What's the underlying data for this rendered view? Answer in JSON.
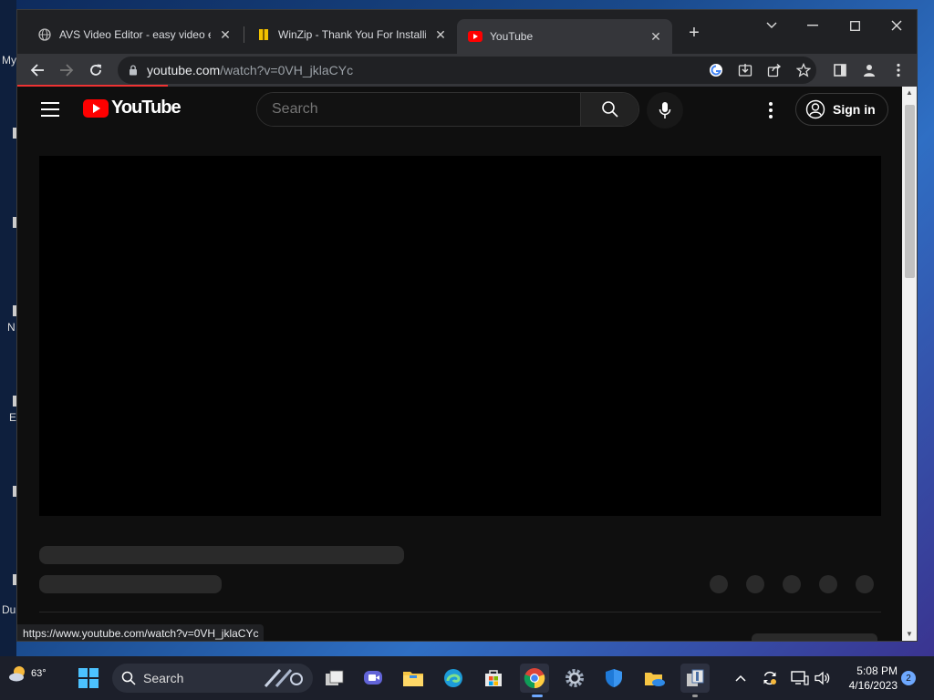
{
  "desktop": {
    "labels": [
      "My",
      "N",
      "E",
      "Du"
    ]
  },
  "browser": {
    "tabs": [
      {
        "title": "AVS Video Editor - easy video editing",
        "favicon": "globe-icon"
      },
      {
        "title": "WinZip - Thank You For Installing",
        "favicon": "winzip-icon"
      },
      {
        "title": "YouTube",
        "favicon": "youtube-icon",
        "active": true
      }
    ],
    "new_tab_label": "+",
    "close_glyph": "✕",
    "url_host": "youtube.com",
    "url_path": "/watch?v=0VH_jklaCYc",
    "status_url": "https://www.youtube.com/watch?v=0VH_jklaCYc"
  },
  "youtube": {
    "logo_text": "YouTube",
    "search_placeholder": "Search",
    "signin_label": "Sign in"
  },
  "taskbar": {
    "weather_temp": "63°",
    "search_label": "Search",
    "time": "5:08 PM",
    "date": "4/16/2023",
    "notification_count": "2"
  },
  "colors": {
    "youtube_red": "#ff0000",
    "page_bg": "#0f0f0f",
    "chrome_toolbar": "#35363a"
  }
}
